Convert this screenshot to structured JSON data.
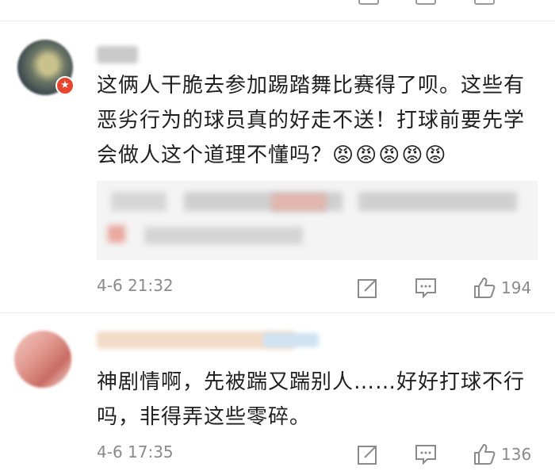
{
  "comments": [
    {
      "text": "这俩人干脆去参加踢踏舞比赛得了呗。这些有恶劣行为的球员真的好走不送！打球前要先学会做人这个道理不懂吗？",
      "emojis": "😡😡😡😡😡",
      "timestamp": "4-6 21:32",
      "likes": "194",
      "icons": {
        "repost": "share-icon",
        "comment": "comment-icon",
        "like": "thumbs-up-icon"
      }
    },
    {
      "text": "神剧情啊，先被踹又踹别人……好好打球不行吗，非得弄这些零碎。",
      "timestamp": "4-6 17:35",
      "likes": "136",
      "icons": {
        "repost": "share-icon",
        "comment": "comment-icon",
        "like": "thumbs-up-icon"
      }
    }
  ],
  "colors": {
    "verified_badge": "#e8452e",
    "meta_gray": "#8a8a8a"
  }
}
